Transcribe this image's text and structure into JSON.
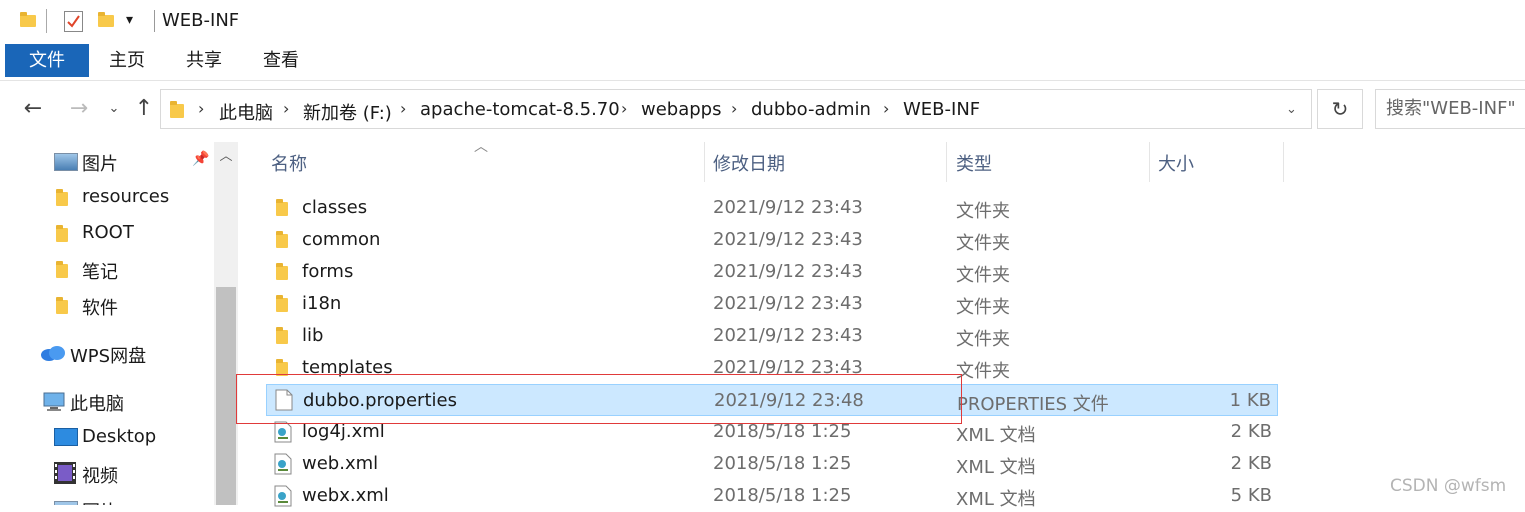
{
  "window": {
    "title": "WEB-INF"
  },
  "ribbon": {
    "tabs": [
      "文件",
      "主页",
      "共享",
      "查看"
    ]
  },
  "address": {
    "crumbs": [
      "此电脑",
      "新加卷 (F:)",
      "apache-tomcat-8.5.70",
      "webapps",
      "dubbo-admin",
      "WEB-INF"
    ],
    "separator": "›",
    "search_placeholder": "搜索\"WEB-INF\""
  },
  "sidebar": {
    "items": [
      {
        "label": "图片",
        "icon": "pictures-icon",
        "pinned": true
      },
      {
        "label": "resources",
        "icon": "folder-icon"
      },
      {
        "label": "ROOT",
        "icon": "folder-icon"
      },
      {
        "label": "笔记",
        "icon": "folder-icon"
      },
      {
        "label": "软件",
        "icon": "folder-icon"
      },
      {
        "label": "WPS网盘",
        "icon": "cloud-icon"
      },
      {
        "label": "此电脑",
        "icon": "computer-icon"
      },
      {
        "label": "Desktop",
        "icon": "desktop-icon"
      },
      {
        "label": "视频",
        "icon": "video-icon"
      },
      {
        "label": "图片",
        "icon": "pictures-icon"
      }
    ]
  },
  "columns": {
    "name": "名称",
    "date": "修改日期",
    "type": "类型",
    "size": "大小"
  },
  "files": [
    {
      "name": "classes",
      "date": "2021/9/12 23:43",
      "type": "文件夹",
      "size": "",
      "kind": "folder"
    },
    {
      "name": "common",
      "date": "2021/9/12 23:43",
      "type": "文件夹",
      "size": "",
      "kind": "folder"
    },
    {
      "name": "forms",
      "date": "2021/9/12 23:43",
      "type": "文件夹",
      "size": "",
      "kind": "folder"
    },
    {
      "name": "i18n",
      "date": "2021/9/12 23:43",
      "type": "文件夹",
      "size": "",
      "kind": "folder"
    },
    {
      "name": "lib",
      "date": "2021/9/12 23:43",
      "type": "文件夹",
      "size": "",
      "kind": "folder"
    },
    {
      "name": "templates",
      "date": "2021/9/12 23:43",
      "type": "文件夹",
      "size": "",
      "kind": "folder"
    },
    {
      "name": "dubbo.properties",
      "date": "2021/9/12 23:48",
      "type": "PROPERTIES 文件",
      "size": "1 KB",
      "kind": "file",
      "selected": true
    },
    {
      "name": "log4j.xml",
      "date": "2018/5/18 1:25",
      "type": "XML 文档",
      "size": "2 KB",
      "kind": "xml"
    },
    {
      "name": "web.xml",
      "date": "2018/5/18 1:25",
      "type": "XML 文档",
      "size": "2 KB",
      "kind": "xml"
    },
    {
      "name": "webx.xml",
      "date": "2018/5/18 1:25",
      "type": "XML 文档",
      "size": "5 KB",
      "kind": "xml"
    }
  ],
  "watermark": "CSDN @wfsm",
  "colors": {
    "accent": "#1a66b8",
    "selection": "#cce8ff",
    "highlight_border": "#e03a3a"
  }
}
